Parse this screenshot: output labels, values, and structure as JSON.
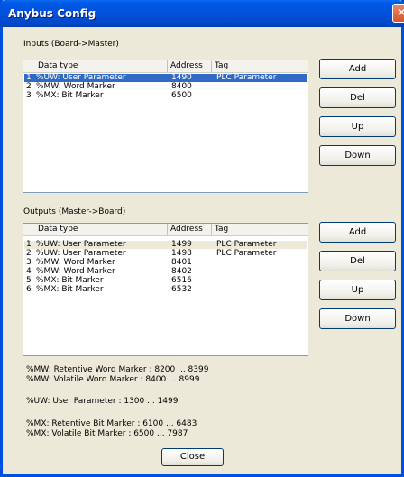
{
  "window": {
    "title": "Anybus Config"
  },
  "inputs": {
    "label": "Inputs (Board->Master)",
    "columns": [
      "Data type",
      "Address",
      "Tag"
    ],
    "rows": [
      {
        "num": "1",
        "type": "%UW: User Parameter",
        "address": "1490",
        "tag": "PLC Parameter"
      },
      {
        "num": "2",
        "type": "%MW: Word Marker",
        "address": "8400",
        "tag": ""
      },
      {
        "num": "3",
        "type": "%MX: Bit Marker",
        "address": "6500",
        "tag": ""
      }
    ],
    "buttons": {
      "add": "Add",
      "del": "Del",
      "up": "Up",
      "down": "Down"
    }
  },
  "outputs": {
    "label": "Outputs (Master->Board)",
    "columns": [
      "Data type",
      "Address",
      "Tag"
    ],
    "rows": [
      {
        "num": "1",
        "type": "%UW: User Parameter",
        "address": "1499",
        "tag": "PLC Parameter"
      },
      {
        "num": "2",
        "type": "%UW: User Parameter",
        "address": "1498",
        "tag": "PLC Parameter"
      },
      {
        "num": "3",
        "type": "%MW: Word Marker",
        "address": "8401",
        "tag": ""
      },
      {
        "num": "4",
        "type": "%MW: Word Marker",
        "address": "8402",
        "tag": ""
      },
      {
        "num": "5",
        "type": "%MX: Bit Marker",
        "address": "6516",
        "tag": ""
      },
      {
        "num": "6",
        "type": "%MX: Bit Marker",
        "address": "6532",
        "tag": ""
      }
    ],
    "buttons": {
      "add": "Add",
      "del": "Del",
      "up": "Up",
      "down": "Down"
    }
  },
  "info": [
    "%MW: Retentive Word Marker : 8200 ... 8399",
    "%MW: Volatile Word Marker : 8400 ... 8999",
    "%UW: User Parameter : 1300 ... 1499",
    "%MX: Retentive Bit Marker : 6100 ... 6483",
    "%MX: Volatile Bit Marker : 6500 ... 7987"
  ],
  "footer": {
    "close_label": "Close"
  }
}
